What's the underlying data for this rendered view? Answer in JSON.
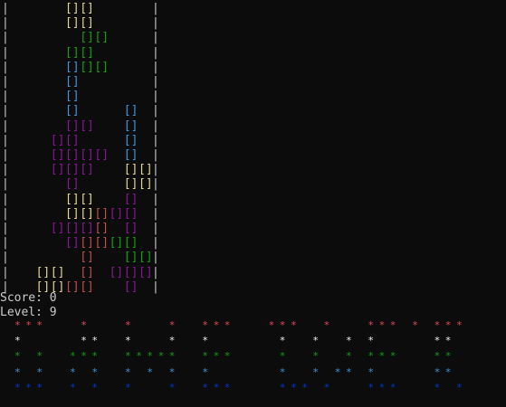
{
  "board": {
    "wall_char": "|",
    "rows": 20,
    "cols": 10,
    "block_glyph": "[]",
    "colors": {
      "Y": "#e6d79a",
      "G": "#13a10e",
      "C": "#3a96dd",
      "M": "#881798",
      "R": "#c0504d"
    },
    "grid": [
      "...YY.....",
      "...YY.....",
      "....GG....",
      "...GG.....",
      "...CGG....",
      "...C......",
      "...C......",
      "...C...C..",
      "...MM..C..",
      "..MM...C..",
      "..MMMM.C..",
      "..MMM..YY.",
      "...M...YY.",
      "...YY..M..",
      "...YYRMM..",
      "..MMMR.M..",
      "...MRRGG..",
      "....R..GG.",
      ".YY.R.MMM.",
      ".YYRR..M.."
    ]
  },
  "status": {
    "score_line": "Score: 0",
    "level_line": "Level: 9"
  },
  "banner": {
    "glyph": "*",
    "colors": {
      "r": "#e74856",
      "w": "#f2f2f2",
      "g": "#13a10e",
      "b": "#3a96dd",
      "d": "#0037da"
    },
    "rows": [
      {
        "color": "r",
        "cols": [
          1,
          2,
          3,
          7,
          11,
          15,
          18,
          19,
          20,
          24,
          25,
          26,
          29,
          33,
          34,
          35,
          37,
          39,
          40,
          41
        ]
      },
      {
        "color": "w",
        "cols": [
          1,
          7,
          8,
          11,
          15,
          18,
          25,
          28,
          31,
          33,
          39,
          40
        ]
      },
      {
        "color": "g",
        "cols": [
          1,
          3,
          6,
          7,
          8,
          11,
          12,
          13,
          14,
          15,
          18,
          19,
          20,
          25,
          28,
          31,
          33,
          34,
          35,
          39,
          40
        ]
      },
      {
        "color": "b",
        "cols": [
          1,
          3,
          6,
          8,
          11,
          13,
          15,
          18,
          25,
          28,
          30,
          31,
          33,
          39,
          40
        ]
      },
      {
        "color": "d",
        "cols": [
          1,
          2,
          3,
          6,
          8,
          11,
          15,
          18,
          19,
          20,
          25,
          26,
          27,
          29,
          33,
          34,
          35,
          39,
          41
        ]
      }
    ]
  }
}
